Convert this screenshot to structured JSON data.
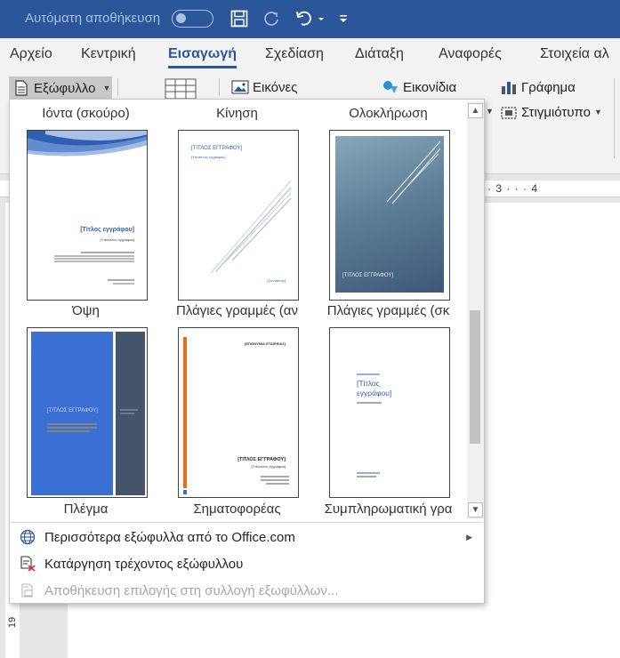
{
  "titlebar": {
    "autosave_label": "Αυτόματη αποθήκευση",
    "save_icon": "save-icon",
    "redo_icon": "redo-icon",
    "undo_icon": "undo-icon",
    "customize_icon": "customize-qat-icon"
  },
  "tabs": [
    "Αρχείο",
    "Κεντρική",
    "Εισαγωγή",
    "Σχεδίαση",
    "Διάταξη",
    "Αναφορές",
    "Στοιχεία αλ"
  ],
  "active_tab": "Εισαγωγή",
  "ribbon": {
    "cover_label": "Εξώφυλλο",
    "pictures_label": "Εικόνες",
    "icons_label": "Εικονίδια",
    "chart_label": "Γράφημα",
    "screenshot_label": "Στιγμιότυπο"
  },
  "ruler": {
    "marks": "· 3 · · · 4",
    "v_num": "19"
  },
  "gallery": {
    "top_labels": [
      "Ιόντα (σκούρο)",
      "Κίνηση",
      "Ολοκλήρωση"
    ],
    "row1_labels": [
      "Όψη",
      "Πλάγιες γραμμές (αν",
      "Πλάγιες γραμμές (σκ"
    ],
    "row2_labels": [
      "Πλέγμα",
      "Σηματοφορέας",
      "Συμπληρωματική γρα"
    ],
    "thumbs": {
      "opsi_title": "[Τίτλος εγγράφου]",
      "opsi_subtitle": "[Υπότιτλος εγγράφου]",
      "plagies1_title": "[ΤΙΤΛΟΣ ΕΓΓΡΑΦΟΥ]",
      "plagies1_subtitle": "[Υπότιτλος εγγράφου]",
      "plagies1_author": "[Συντάκτης]",
      "plagies2_title": "[ΤΙΤΛΟΣ ΕΓΓΡΑΦΟΥ]",
      "plegma_title": "[ΤΙΤΛΟΣ ΕΓΓΡΑΦΟΥ]",
      "simatoforeas_company": "[ΕΠΩΝΥΜΙΑ ΕΤΑΙΡΕΙΑΣ]",
      "simatoforeas_title": "[ΤΙΤΛΟΣ ΕΓΓΡΑΦΟΥ]",
      "simatoforeas_subtitle": "[Υπότιτλος εγγράφου]",
      "symplir_title": "[Τίτλος εγγράφου]"
    },
    "menu": {
      "more_label": "Περισσότερα εξώφυλλα από το Office.com",
      "remove_label": "Κατάργηση τρέχοντος εξώφυλλου",
      "save_label": "Αποθήκευση επιλογής στη συλλογή εξωφύλλων..."
    }
  },
  "colors": {
    "titlebar": "#2b579a",
    "accent": "#2b579a",
    "ribbon_bg": "#f3f3f3",
    "plegma_blue": "#3b6fd4",
    "plegma_slate": "#44546a",
    "orange_bar": "#e0701a"
  }
}
